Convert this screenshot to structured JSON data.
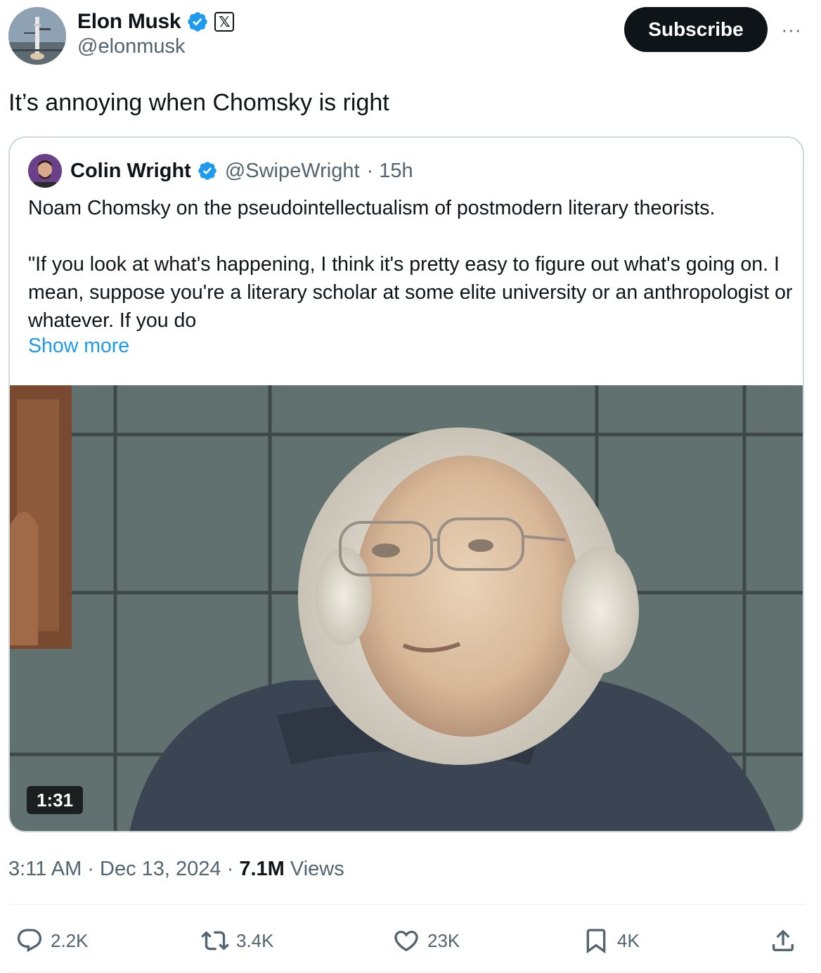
{
  "post": {
    "author": {
      "display_name": "Elon Musk",
      "handle": "@elonmusk",
      "affiliate_badge": "𝕏"
    },
    "subscribe_label": "Subscribe",
    "more_label": "···",
    "text": "It’s annoying when Chomsky is right",
    "quote": {
      "author": {
        "display_name": "Colin Wright",
        "handle": "@SwipeWright",
        "time": "· 15h"
      },
      "paragraph_1": "Noam Chomsky on the pseudointellectualism of postmodern literary theorists.",
      "paragraph_2": "\"If you look at what's happening, I think it's pretty easy to figure out what's going on. I mean, suppose you're a literary scholar at some elite university or an anthropologist or whatever. If you do",
      "show_more_label": "Show more",
      "video": {
        "duration": "1:31"
      }
    },
    "meta": {
      "time": "3:11 AM",
      "separator": " · ",
      "date": "Dec 13, 2024",
      "views_count": "7.1M",
      "views_label": "Views"
    },
    "actions": {
      "replies": "2.2K",
      "reposts": "3.4K",
      "likes": "23K",
      "bookmarks": "4K"
    }
  },
  "colors": {
    "text": "#0f1419",
    "secondary": "#536471",
    "link": "#1d9bf0",
    "verified": "#1d9bf0",
    "border": "#cfd9de"
  }
}
